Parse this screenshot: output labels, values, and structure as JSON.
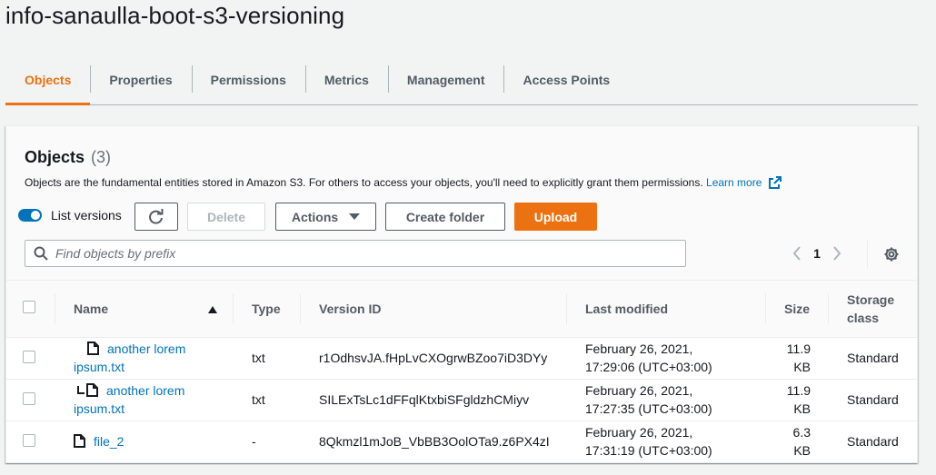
{
  "bucket": {
    "title": "info-sanaulla-boot-s3-versioning"
  },
  "tabs": [
    {
      "label": "Objects",
      "active": true
    },
    {
      "label": "Properties"
    },
    {
      "label": "Permissions"
    },
    {
      "label": "Metrics"
    },
    {
      "label": "Management"
    },
    {
      "label": "Access Points"
    }
  ],
  "objects_panel": {
    "title": "Objects",
    "count": "(3)",
    "description": "Objects are the fundamental entities stored in Amazon S3. For others to access your objects, you'll need to explicitly grant them permissions.",
    "learn_more": "Learn more",
    "list_versions_label": "List versions",
    "list_versions_on": true,
    "buttons": {
      "delete": "Delete",
      "actions": "Actions",
      "create_folder": "Create folder",
      "upload": "Upload"
    },
    "search_placeholder": "Find objects by prefix",
    "page": "1"
  },
  "table": {
    "columns": [
      "Name",
      "Type",
      "Version ID",
      "Last modified",
      "Size",
      "Storage class"
    ],
    "rows": [
      {
        "name_a": "another lorem",
        "name_b": "ipsum.txt",
        "type": "txt",
        "version_id": "r1OdhsvJA.fHpLvCXOgrwBZoo7iD3DYy",
        "modified_a": "February 26, 2021,",
        "modified_b": "17:29:06 (UTC+03:00)",
        "size_a": "11.9",
        "size_b": "KB",
        "storage": "Standard"
      },
      {
        "name_a": "another lorem",
        "name_b": "ipsum.txt",
        "type": "txt",
        "version_id": "SILExTsLc1dFFqlKtxbiSFgldzhCMiyv",
        "modified_a": "February 26, 2021,",
        "modified_b": "17:27:35 (UTC+03:00)",
        "size_a": "11.9",
        "size_b": "KB",
        "storage": "Standard"
      },
      {
        "name_a": "file_2",
        "name_b": "",
        "type": "-",
        "version_id": "8Qkmzl1mJoB_VbBB3OolOTa9.z6PX4zI",
        "modified_a": "February 26, 2021,",
        "modified_b": "17:31:19 (UTC+03:00)",
        "size_a": "6.3",
        "size_b": "KB",
        "storage": "Standard"
      }
    ]
  },
  "colors": {
    "accent": "#ec7211",
    "link": "#0073bb",
    "toggle": "#0073bb"
  }
}
